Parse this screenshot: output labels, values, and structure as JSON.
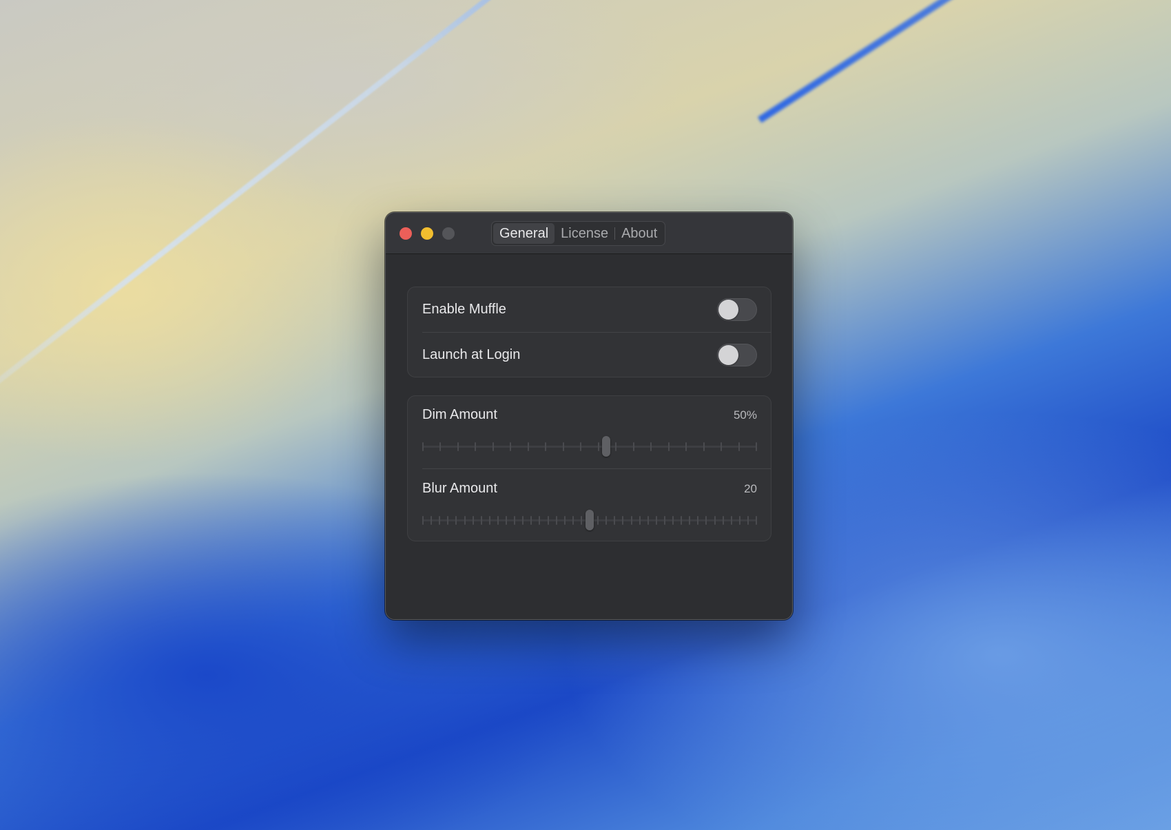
{
  "window": {
    "tabs": [
      {
        "label": "General",
        "active": true
      },
      {
        "label": "License",
        "active": false
      },
      {
        "label": "About",
        "active": false
      }
    ]
  },
  "toggles": [
    {
      "label": "Enable Muffle",
      "on": false
    },
    {
      "label": "Launch at Login",
      "on": false
    }
  ],
  "sliders": {
    "dim": {
      "label": "Dim Amount",
      "value_text": "50%",
      "fraction": 0.55,
      "tick_count": 20
    },
    "blur": {
      "label": "Blur Amount",
      "value_text": "20",
      "fraction": 0.5,
      "tick_count": 41
    }
  },
  "colors": {
    "close": "#ec5f59",
    "minimize": "#f2be2f",
    "zoom_disabled": "#545559",
    "window_bg": "#2d2e31"
  }
}
